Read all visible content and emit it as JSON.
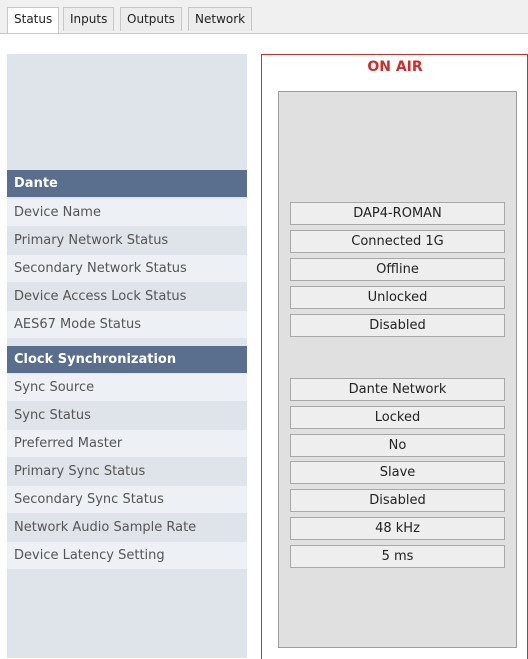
{
  "tabs": [
    {
      "label": "Status"
    },
    {
      "label": "Inputs"
    },
    {
      "label": "Outputs"
    },
    {
      "label": "Network"
    }
  ],
  "status_banner": "ON AIR",
  "dante": {
    "header": "Dante",
    "rows": [
      {
        "label": "Device Name",
        "value": "DAP4-ROMAN"
      },
      {
        "label": "Primary Network Status",
        "value": "Connected 1G"
      },
      {
        "label": "Secondary Network Status",
        "value": "Offline"
      },
      {
        "label": "Device Access Lock Status",
        "value": "Unlocked"
      },
      {
        "label": "AES67 Mode Status",
        "value": "Disabled"
      }
    ]
  },
  "clock": {
    "header": "Clock Synchronization",
    "rows": [
      {
        "label": "Sync Source",
        "value": "Dante Network"
      },
      {
        "label": "Sync Status",
        "value": "Locked"
      },
      {
        "label": "Preferred Master",
        "value": "No"
      },
      {
        "label": "Primary Sync Status",
        "value": "Slave"
      },
      {
        "label": "Secondary Sync Status",
        "value": "Disabled"
      },
      {
        "label": "Network Audio Sample Rate",
        "value": "48 kHz"
      },
      {
        "label": "Device Latency Setting",
        "value": "5 ms"
      }
    ]
  }
}
